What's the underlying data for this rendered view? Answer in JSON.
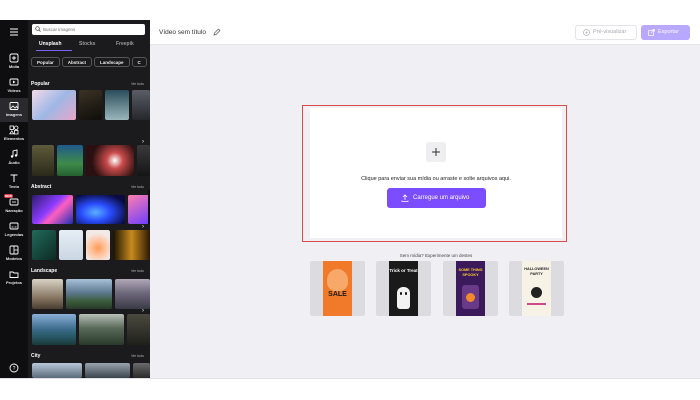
{
  "rail": {
    "items": [
      {
        "label": "",
        "icon": "hamburger-menu-icon"
      },
      {
        "label": "Mídia",
        "icon": "media-plus-icon"
      },
      {
        "label": "Vídeos",
        "icon": "video-icon"
      },
      {
        "label": "Imagens",
        "icon": "image-icon",
        "active": true
      },
      {
        "label": "Elementos",
        "icon": "shapes-icon"
      },
      {
        "label": "Áudio",
        "icon": "music-note-icon"
      },
      {
        "label": "Texto",
        "icon": "text-icon"
      },
      {
        "label": "Narração",
        "icon": "narration-icon",
        "badge": "NEW"
      },
      {
        "label": "Legendas",
        "icon": "captions-icon"
      },
      {
        "label": "Modelos",
        "icon": "templates-icon"
      },
      {
        "label": "Projetos",
        "icon": "folder-icon"
      }
    ],
    "help_icon": "help-circle-icon"
  },
  "panel": {
    "search_placeholder": "Buscar imagens",
    "tabs": [
      "Unsplash",
      "Stocks",
      "Freepik"
    ],
    "active_tab": "Unsplash",
    "chips": [
      "Popular",
      "Abstract",
      "Landscape",
      "C"
    ],
    "sections": [
      {
        "title": "Popular",
        "see_all": "Ver tudo"
      },
      {
        "title": "Abstract",
        "see_all": "Ver tudo"
      },
      {
        "title": "Landscape",
        "see_all": "Ver tudo"
      },
      {
        "title": "City",
        "see_all": "Ver tudo"
      }
    ]
  },
  "topbar": {
    "title": "Vídeo sem título",
    "preview_label": "Pré-visualizar",
    "export_label": "Exportar"
  },
  "canvas": {
    "upload_text": "Clique para enviar sua mídia ou arraste e solte arquivos aqui.",
    "upload_button": "Carregue um arquivo",
    "suggest_text": "Sem mídia? Experimente um destes",
    "templates": [
      {
        "title": "SALE"
      },
      {
        "title": "Trick or Treat"
      },
      {
        "title": "SOME THING SPOOKY"
      },
      {
        "title": "HALLOWEEN PARTY"
      }
    ]
  },
  "colors": {
    "accent": "#7b4dff",
    "accent_disabled": "#b9a8ff",
    "highlight": "#d94a4a",
    "rail_bg": "#0e0e10",
    "panel_bg": "#1b1b1e"
  }
}
